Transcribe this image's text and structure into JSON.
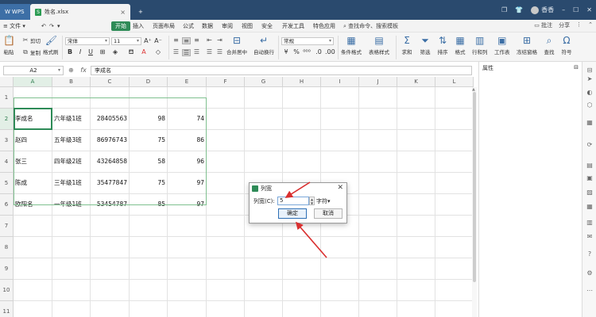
{
  "titlebar": {
    "app_tab": "WPS",
    "file_tab": "姓名.xlsx",
    "add_tab": "+",
    "user": "香香"
  },
  "menu": {
    "items": [
      "文件",
      "开始",
      "插入",
      "页面布局",
      "公式",
      "数据",
      "审阅",
      "视图",
      "安全",
      "开发工具",
      "特色应用"
    ],
    "search": "查找命令、搜索模板",
    "right": [
      "批注",
      "分享"
    ]
  },
  "ribbon": {
    "paste": "粘贴",
    "cut": "剪切",
    "copy": "复制",
    "format_painter": "格式刷",
    "font_name": "宋体",
    "font_size": "11",
    "merge_center": "合并居中",
    "wrap_text": "自动换行",
    "number_format": "常规",
    "conditional_format": "条件格式",
    "table_style": "表格样式",
    "sum": "求和",
    "filter": "筛选",
    "sort": "排序",
    "format": "格式",
    "row_col": "行和列",
    "worksheet": "工作表",
    "freeze": "冻结窗格",
    "find": "查找",
    "symbol": "符号"
  },
  "formula_bar": {
    "name_box": "A2",
    "fx": "fx",
    "content": "李成名"
  },
  "grid": {
    "columns": [
      "A",
      "B",
      "C",
      "D",
      "E",
      "F",
      "G",
      "H",
      "I",
      "J",
      "K",
      "L"
    ],
    "rows": [
      "1",
      "2",
      "3",
      "4",
      "5",
      "6",
      "7",
      "8",
      "9",
      "10",
      "11"
    ],
    "selected_cell": "A2",
    "data": [
      [
        "李成名",
        "六年级1班",
        "28405563",
        "98",
        "74"
      ],
      [
        "赵四",
        "五年级3班",
        "86976743",
        "75",
        "86"
      ],
      [
        "张三",
        "四年级2班",
        "43264858",
        "58",
        "96"
      ],
      [
        "陈成",
        "三年级1班",
        "35477847",
        "75",
        "97"
      ],
      [
        "欧阳名",
        "一年级1班",
        "53454787",
        "85",
        "97"
      ]
    ]
  },
  "properties_pane": {
    "title": "属性"
  },
  "dialog": {
    "title": "列宽",
    "label": "列宽(C):",
    "value": "5",
    "unit": "字符",
    "ok": "确定",
    "cancel": "取消"
  },
  "colors": {
    "titlebar": "#2a4a6e",
    "accent_green": "#2e8b57",
    "annotation_arrow": "#d92f2f"
  }
}
